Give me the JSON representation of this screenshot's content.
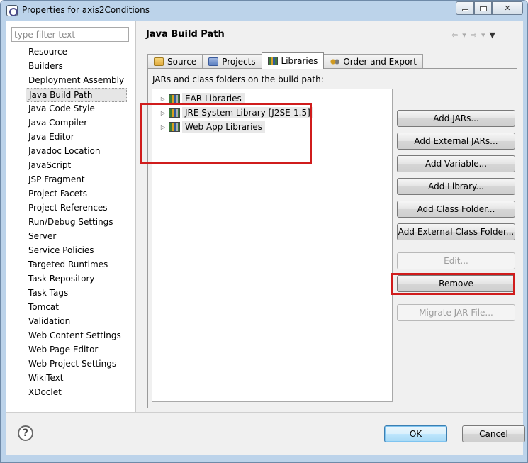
{
  "window": {
    "title": "Properties for axis2Conditions",
    "controls": {
      "minimize": "minimize",
      "maximize": "maximize",
      "close": "✕"
    }
  },
  "filter": {
    "placeholder": "type filter text",
    "value": ""
  },
  "nav": {
    "selected": "Java Build Path",
    "items": [
      "Resource",
      "Builders",
      "Deployment Assembly",
      "Java Build Path",
      "Java Code Style",
      "Java Compiler",
      "Java Editor",
      "Javadoc Location",
      "JavaScript",
      "JSP Fragment",
      "Project Facets",
      "Project References",
      "Run/Debug Settings",
      "Server",
      "Service Policies",
      "Targeted Runtimes",
      "Task Repository",
      "Task Tags",
      "Tomcat",
      "Validation",
      "Web Content Settings",
      "Web Page Editor",
      "Web Project Settings",
      "WikiText",
      "XDoclet"
    ]
  },
  "page": {
    "title": "Java Build Path",
    "tabs": [
      {
        "label": "Source",
        "icon": "source-folder-icon"
      },
      {
        "label": "Projects",
        "icon": "projects-icon"
      },
      {
        "label": "Libraries",
        "icon": "libraries-icon",
        "active": true
      },
      {
        "label": "Order and Export",
        "icon": "order-export-icon"
      }
    ],
    "panel_label": "JARs and class folders on the build path:",
    "libraries": [
      {
        "label": "EAR Libraries",
        "icon": "library-icon"
      },
      {
        "label": "JRE System Library [J2SE-1.5]",
        "icon": "library-icon"
      },
      {
        "label": "Web App Libraries",
        "icon": "library-icon"
      }
    ],
    "buttons": {
      "add_jars": "Add JARs...",
      "add_external_jars": "Add External JARs...",
      "add_variable": "Add Variable...",
      "add_library": "Add Library...",
      "add_class_folder": "Add Class Folder...",
      "add_external_class_folder": "Add External Class Folder...",
      "edit": "Edit...",
      "remove": "Remove",
      "migrate_jar": "Migrate JAR File..."
    }
  },
  "footer": {
    "help": "?",
    "ok": "OK",
    "cancel": "Cancel"
  },
  "colors": {
    "highlight": "#d01c1c",
    "ok_border": "#3c7fb1",
    "window_frame": "#bcd3ea"
  }
}
